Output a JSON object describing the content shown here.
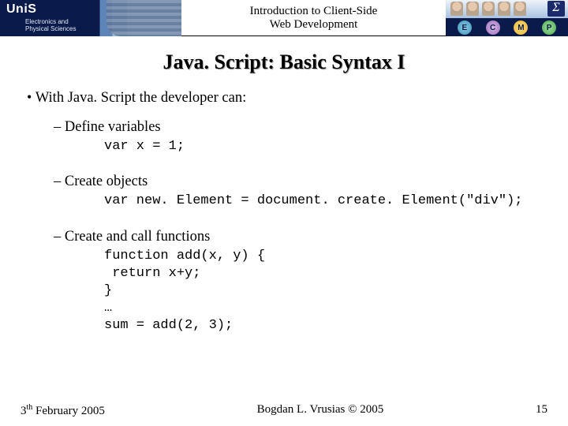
{
  "header": {
    "uni_logo": "UniS",
    "dept_line1": "Electronics and",
    "dept_line2": "Physical Sciences",
    "course_line1": "Introduction to Client-Side",
    "course_line2": "Web Development",
    "sigma": "Σ",
    "badges": [
      "E",
      "C",
      "M",
      "P"
    ]
  },
  "slide": {
    "title": "Java. Script: Basic Syntax I",
    "intro": "With Java. Script the developer can:",
    "items": [
      {
        "label": "Define variables",
        "code": "var x = 1;"
      },
      {
        "label": "Create objects",
        "code": "var new. Element = document. create. Element(\"div\");"
      },
      {
        "label": "Create and call functions",
        "code": "function add(x, y) {\n return x+y;\n}\n…\nsum = add(2, 3);"
      }
    ]
  },
  "footer": {
    "date_prefix": "3",
    "date_sup": "th",
    "date_suffix": " February 2005",
    "author": "Bogdan L. Vrusias © 2005",
    "page": "15"
  }
}
